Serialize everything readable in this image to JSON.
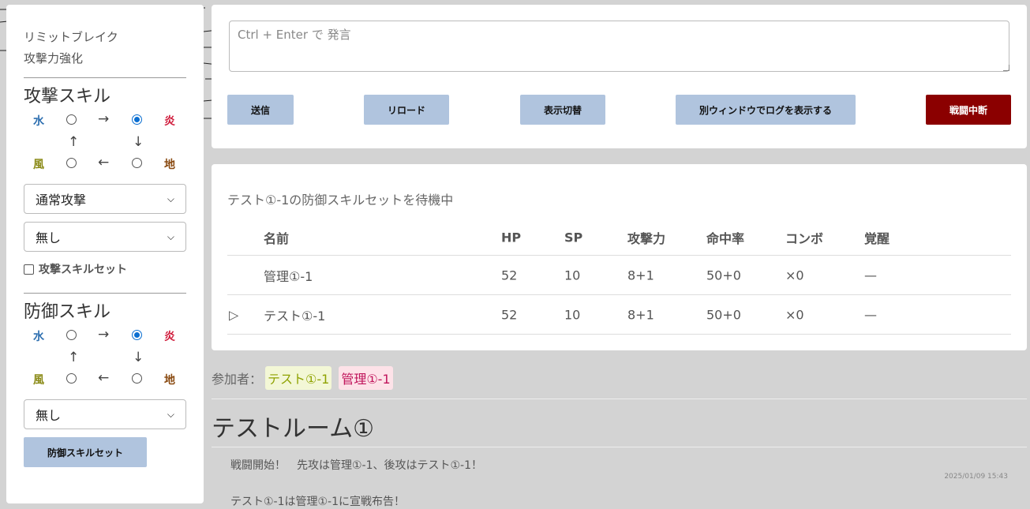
{
  "status": {
    "line1": "リミットブレイク",
    "line2": "攻撃力強化"
  },
  "attack": {
    "title": "攻撃スキル",
    "elements": {
      "water": "水",
      "fire": "炎",
      "wind": "風",
      "earth": "地"
    },
    "arrows": {
      "right": "→",
      "up": "↑",
      "down": "↓",
      "left": "←"
    },
    "selected_element": "fire",
    "skill_select": "通常攻撃",
    "sub_select": "無し",
    "checkbox_label": "攻撃スキルセット",
    "checkbox_checked": false
  },
  "defense": {
    "title": "防御スキル",
    "elements": {
      "water": "水",
      "fire": "炎",
      "wind": "風",
      "earth": "地"
    },
    "arrows": {
      "right": "→",
      "up": "↑",
      "down": "↓",
      "left": "←"
    },
    "selected_element": "fire",
    "skill_select": "無し",
    "button_label": "防御スキルセット"
  },
  "composer": {
    "placeholder": "Ctrl + Enter で 発言",
    "buttons": {
      "send": "送信",
      "reload": "リロード",
      "toggle": "表示切替",
      "log_window": "別ウィンドウでログを表示する",
      "abort": "戦闘中断"
    }
  },
  "battle": {
    "waiting": "テスト①-1の防御スキルセットを待機中",
    "headers": [
      "",
      "名前",
      "HP",
      "SP",
      "攻撃力",
      "命中率",
      "コンボ",
      "覚醒"
    ],
    "rows": [
      [
        "",
        "管理①-1",
        "52",
        "10",
        "8+1",
        "50+0",
        "×0",
        "—"
      ],
      [
        "▷",
        "テスト①-1",
        "52",
        "10",
        "8+1",
        "50+0",
        "×0",
        "—"
      ]
    ]
  },
  "participants": {
    "label": "参加者：",
    "members": [
      "テスト①-1",
      "管理①-1"
    ]
  },
  "room": {
    "title": "テストルーム①",
    "logs": [
      "戦闘開始！　先攻は管理①-1、後攻はテスト①-1！",
      "テスト①-1は管理①-1に宣戦布告！"
    ],
    "timestamp": "2025/01/09 15:43"
  },
  "colors": {
    "button": "#b0c4de",
    "danger": "#8b0000",
    "water": "#2e6fb0",
    "fire": "#d01b3b",
    "wind": "#8a8a17",
    "earth": "#8a4b12"
  }
}
